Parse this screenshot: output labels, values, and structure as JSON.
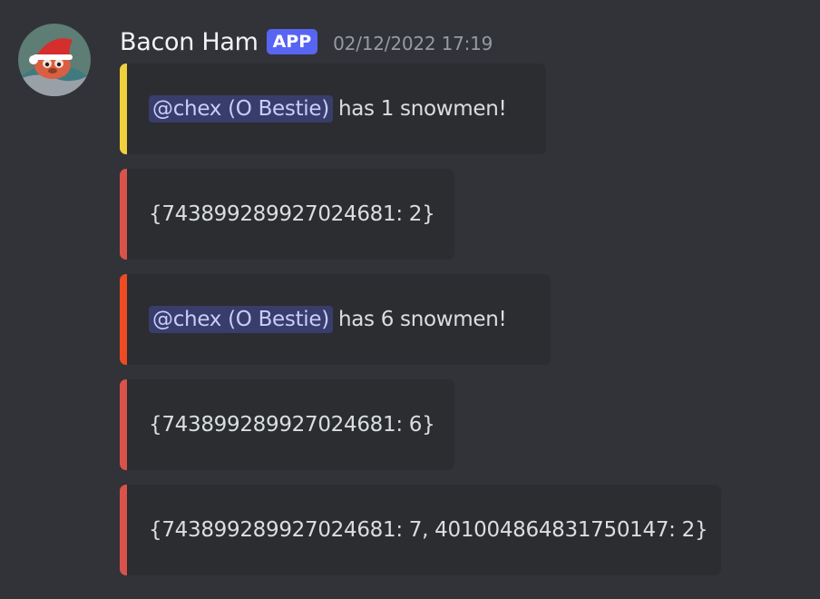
{
  "message": {
    "username": "Bacon Ham",
    "badge": "APP",
    "timestamp": "02/12/2022 17:19",
    "avatar_icon": "chick-santa-hat-avatar",
    "embeds": [
      {
        "color": "#f0d03c",
        "mention": "@chex (O Bestie)",
        "text": "has 1 snowmen!"
      },
      {
        "color": "#d9534a",
        "mention": null,
        "text": "{743899289927024681: 2}"
      },
      {
        "color": "#ee4b23",
        "mention": "@chex (O Bestie)",
        "text": "has 6 snowmen!"
      },
      {
        "color": "#d9534a",
        "mention": null,
        "text": "{743899289927024681: 6}"
      },
      {
        "color": "#d9534a",
        "mention": null,
        "text": "{743899289927024681: 7, 401004864831750147: 2}"
      }
    ]
  }
}
